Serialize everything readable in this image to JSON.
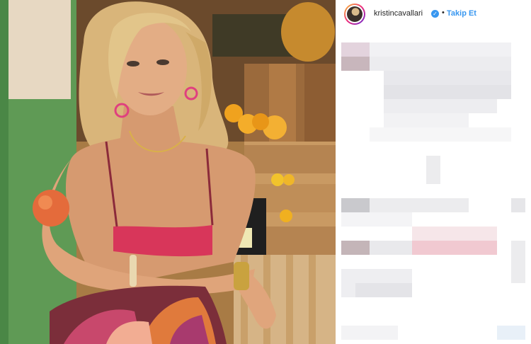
{
  "header": {
    "username": "kristincavallari",
    "verified_icon": "verified-badge-icon",
    "separator": "•",
    "follow_label": "Takip Et"
  },
  "colors": {
    "link_blue": "#3897f0",
    "text": "#262626",
    "border": "#efefef"
  }
}
